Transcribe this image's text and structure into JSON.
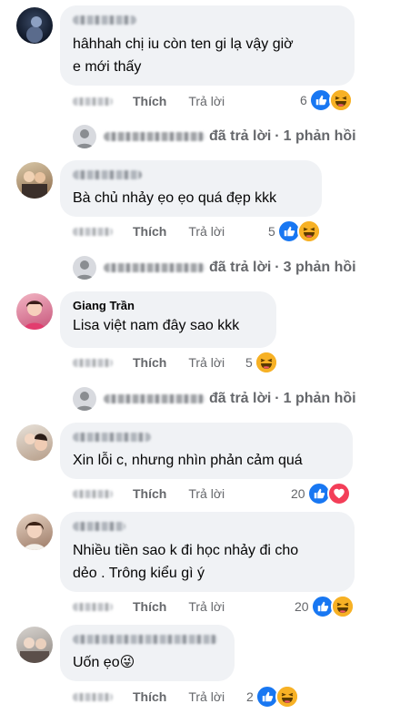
{
  "comments": [
    {
      "name": "",
      "text_lines": [
        "hâhhah chị iu còn ten gi lạ vậy giờ",
        "e mới thấy"
      ],
      "like_label": "Thích",
      "reply_label": "Trả lời",
      "reaction_count": "6",
      "reactions": [
        "like-icon",
        "haha-icon"
      ],
      "replies": {
        "verb": "đã trả lời",
        "sep": "·",
        "count": "1 phản hồi"
      }
    },
    {
      "name": "",
      "text_lines": [
        "Bà chủ nhảy ẹo ẹo quá đẹp kkk"
      ],
      "like_label": "Thích",
      "reply_label": "Trả lời",
      "reaction_count": "5",
      "reactions": [
        "like-icon",
        "haha-icon"
      ],
      "replies": {
        "verb": "đã trả lời",
        "sep": "·",
        "count": "3 phản hồi"
      }
    },
    {
      "name": "Giang Trần",
      "text_lines": [
        "Lisa việt nam đây sao kkk"
      ],
      "like_label": "Thích",
      "reply_label": "Trả lời",
      "reaction_count": "5",
      "reactions": [
        "haha-icon"
      ],
      "replies": {
        "verb": "đã trả lời",
        "sep": "·",
        "count": "1 phản hồi"
      }
    },
    {
      "name": "",
      "text_lines": [
        "Xin lỗi c, nhưng nhìn phản cảm quá"
      ],
      "like_label": "Thích",
      "reply_label": "Trả lời",
      "reaction_count": "20",
      "reactions": [
        "like-icon",
        "heart-icon"
      ]
    },
    {
      "name": "",
      "text_lines": [
        "Nhiều tiền sao k đi học nhảy đi cho",
        "dẻo . Trông kiểu gì ý"
      ],
      "like_label": "Thích",
      "reply_label": "Trả lời",
      "reaction_count": "20",
      "reactions": [
        "like-icon",
        "haha-icon"
      ]
    },
    {
      "name": "",
      "text_lines": [
        "Uốn ẹo😜"
      ],
      "like_label": "Thích",
      "reply_label": "Trả lời",
      "reaction_count": "2",
      "reactions": [
        "like-icon",
        "haha-icon"
      ]
    }
  ],
  "colors": {
    "bubble": "#f0f2f5",
    "like_blue": "#1877f2",
    "haha_yellow": "#f7b125",
    "heart_red": "#f33e58",
    "secondary_text": "#65676b"
  }
}
